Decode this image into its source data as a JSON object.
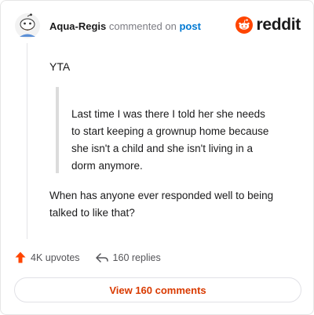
{
  "header": {
    "username": "Aqua-Regis",
    "commented_on": "commented on",
    "post_link": "post",
    "brand_word": "reddit",
    "avatar_icon": "snoo-avatar-icon",
    "brand_icon": "reddit-logo-icon"
  },
  "comment": {
    "first_line": "YTA",
    "quote_lines": [
      "Last time I was there I told her she needs",
      "to start keeping a grownup home because",
      "she isn't a child and she isn't living in a",
      "dorm anymore."
    ],
    "reply_lines": [
      "When has anyone ever responded well to being",
      "talked to like that?"
    ]
  },
  "actions": {
    "upvotes": "4K upvotes",
    "replies": "160 replies",
    "upvote_icon": "upvote-arrow-icon",
    "reply_icon": "reply-arrow-icon"
  },
  "footer": {
    "view_comments": "View 160 comments"
  },
  "colors": {
    "accent": "#ff4500",
    "link": "#0079d3",
    "button_text": "#d93a00"
  }
}
